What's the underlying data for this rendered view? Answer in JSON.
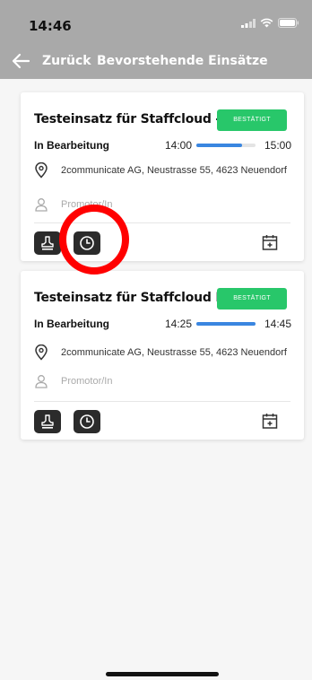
{
  "status_bar": {
    "time": "14:46"
  },
  "nav": {
    "back_label": "Zurück",
    "title": "Bevorstehende Einsätze"
  },
  "colors": {
    "header": "#a9a9a9",
    "badge": "#28c76a",
    "progress": "#3a86e0",
    "annotation": "#ff0000"
  },
  "cards": [
    {
      "title": "Testeinsatz für Staffcloud - 0...",
      "badge": "BESTÄTIGT",
      "state": "In Bearbeitung",
      "start": "14:00",
      "end": "15:00",
      "progress": 0.77,
      "address": "2communicate AG, Neustrasse 55, 4623 Neuendorf",
      "person": "Promotor/In",
      "icons": [
        "stamp-icon",
        "clock-icon",
        "calendar-plus-icon"
      ]
    },
    {
      "title": "Testeinsatz für Staffcloud I -...",
      "badge": "BESTÄTIGT",
      "state": "In Bearbeitung",
      "start": "14:25",
      "end": "14:45",
      "progress": 1.0,
      "address": "2communicate AG, Neustrasse 55, 4623 Neuendorf",
      "person": "Promotor/In",
      "icons": [
        "stamp-icon",
        "clock-icon",
        "calendar-plus-icon"
      ]
    }
  ]
}
